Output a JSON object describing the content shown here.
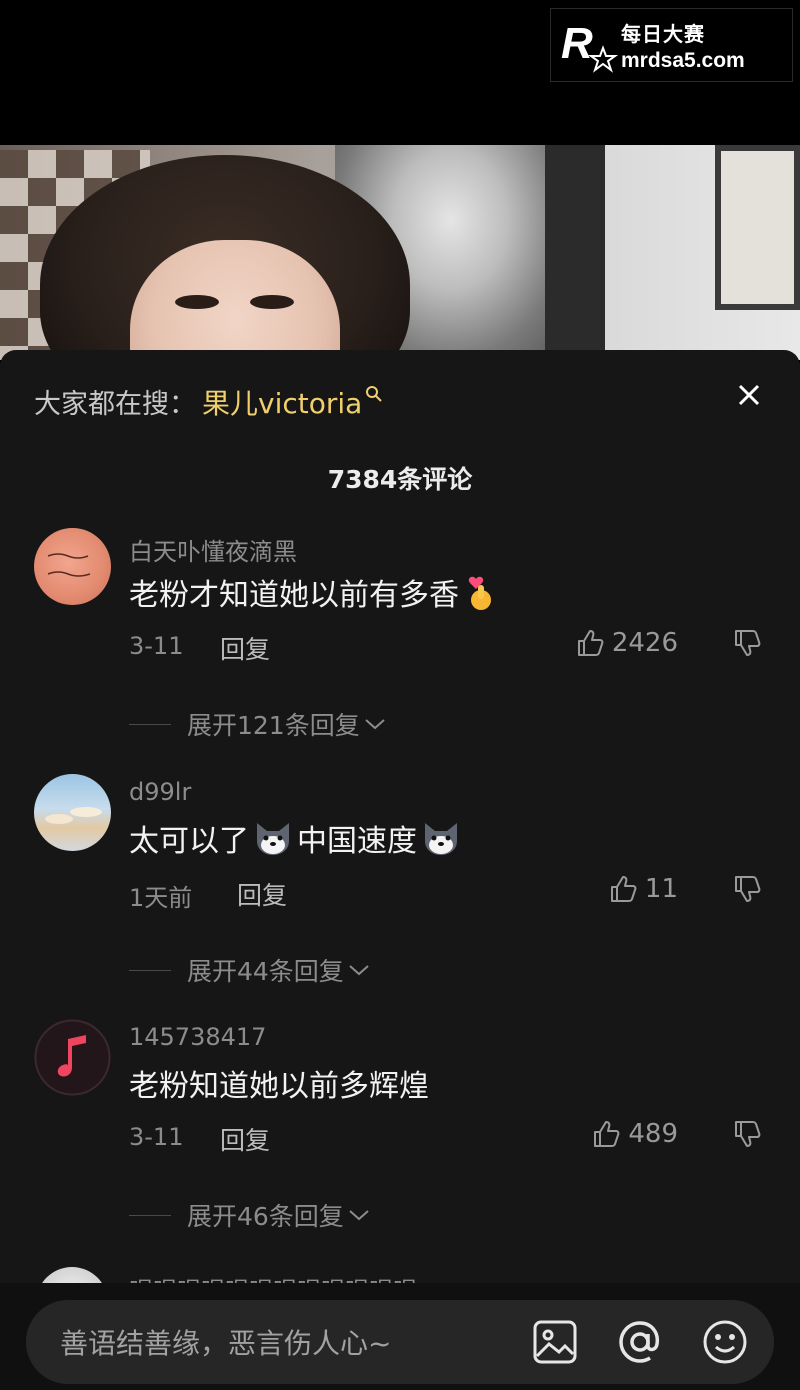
{
  "watermark": {
    "brand_cn": "每日大赛",
    "url": "mrdsa5.com",
    "logo_letter": "R"
  },
  "sheet": {
    "search_label": "大家都在搜：",
    "search_term": "果儿victoria",
    "comment_count": "7384条评论"
  },
  "comments": [
    {
      "username": "白天卟懂夜滴黑",
      "text": "老粉才知道她以前有多香",
      "emoji": "finger-heart-emoji",
      "date": "3-11",
      "reply": "回复",
      "likes": "2426",
      "expand": "展开121条回复"
    },
    {
      "username": "d99lr",
      "text_before": "太可以了",
      "text_after": "中国速度",
      "emoji": "husky-emoji",
      "date": "1天前",
      "reply": "回复",
      "likes": "11",
      "expand": "展开44条回复"
    },
    {
      "username": "145738417",
      "text": "老粉知道她以前多辉煌",
      "date": "3-11",
      "reply": "回复",
      "likes": "489",
      "expand": "展开46条回复"
    }
  ],
  "partial_comment": {
    "username": "喝喝喝喝喝喝喝喝喝喝喝喝"
  },
  "input": {
    "placeholder": "善语结善缘，恶言伤人心~",
    "icons": [
      "image-icon",
      "at-icon",
      "emoji-icon"
    ]
  },
  "colors": {
    "sheet_bg": "#161616",
    "search_highlight": "#f0cf6c",
    "muted_text": "#8c8c8c"
  }
}
